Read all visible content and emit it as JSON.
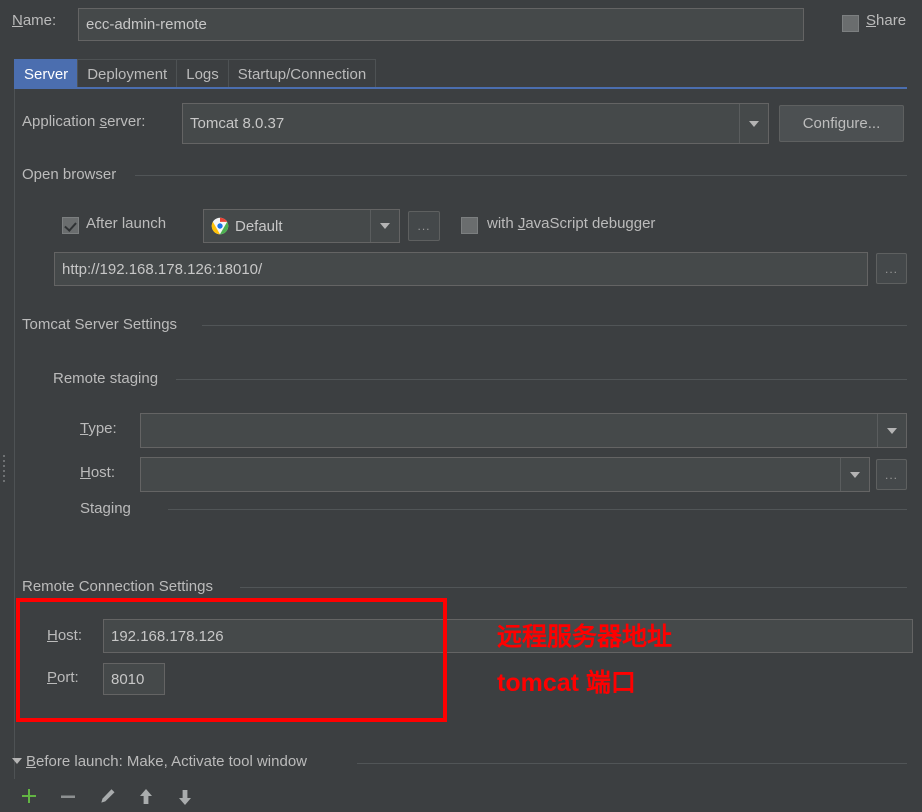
{
  "window": {
    "name_label": "Name:",
    "name_label_mnemonic": "N",
    "name_value": "ecc-admin-remote",
    "share_label": "Share",
    "share_label_mnemonic": "S",
    "share_checked": false
  },
  "tabs": [
    {
      "label": "Server",
      "selected": true
    },
    {
      "label": "Deployment",
      "selected": false
    },
    {
      "label": "Logs",
      "selected": false
    },
    {
      "label": "Startup/Connection",
      "selected": false
    }
  ],
  "server_tab": {
    "application_server": {
      "label": "Application server:",
      "label_mnemonic": "s",
      "value": "Tomcat 8.0.37",
      "configure_button": "Configure..."
    },
    "open_browser": {
      "group_title": "Open browser",
      "after_launch_label": "After launch",
      "after_launch_checked": true,
      "browser_value": "Default",
      "browser_icon": "chrome-icon",
      "browser_dots_label": "...",
      "js_debugger_label": "with JavaScript debugger",
      "js_debugger_label_mnemonic": "J",
      "js_debugger_checked": false,
      "url_value": "http://192.168.178.126:18010/",
      "url_dots_label": "..."
    },
    "tomcat_server_settings": {
      "group_title": "Tomcat Server Settings",
      "remote_staging": {
        "group_title": "Remote staging",
        "type_label": "Type:",
        "type_label_mnemonic": "T",
        "type_value": "",
        "host_label": "Host:",
        "host_label_mnemonic": "H",
        "host_value": "",
        "host_dots_label": "...",
        "staging_group_title": "Staging"
      }
    },
    "remote_connection_settings": {
      "group_title": "Remote Connection Settings",
      "host_label": "Host:",
      "host_label_mnemonic": "H",
      "host_value": "192.168.178.126",
      "port_label": "Port:",
      "port_label_mnemonic": "P",
      "port_value": "8010"
    },
    "annotations": [
      {
        "text": "远程服务器地址",
        "color": "#ff0000"
      },
      {
        "text": "tomcat 端口",
        "color": "#ff0000"
      }
    ],
    "highlight_color": "#ff0000"
  },
  "before_launch": {
    "title": "Before launch: Make, Activate tool window",
    "title_mnemonic": "B",
    "expanded": true,
    "toolbar": [
      {
        "icon": "add-icon",
        "color": "#62b543"
      },
      {
        "icon": "remove-icon",
        "color": "#8d9091"
      },
      {
        "icon": "edit-pencil-icon",
        "color": "#a9acad"
      },
      {
        "icon": "move-up-icon",
        "color": "#a9acad"
      },
      {
        "icon": "move-down-icon",
        "color": "#a9acad"
      }
    ]
  },
  "theme": {
    "background": "#3c3f41",
    "field_background": "#45494a",
    "accent": "#4b6eaf",
    "text": "#bbbbbb"
  }
}
